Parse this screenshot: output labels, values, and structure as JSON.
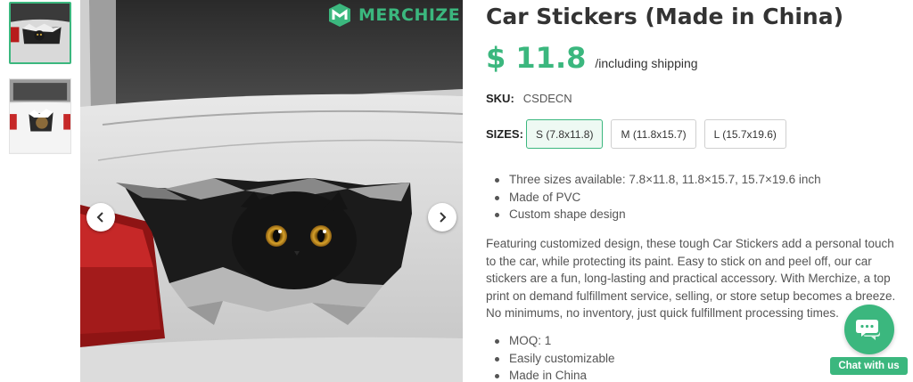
{
  "brand": {
    "watermark": "MERCHIZE",
    "accent_color": "#3bb77e"
  },
  "gallery": {
    "thumbnails": [
      {
        "alt": "cat sticker on car trunk",
        "selected": true
      },
      {
        "alt": "cat sticker on white car",
        "selected": false
      }
    ],
    "prev_icon": "chevron-left-icon",
    "next_icon": "chevron-right-icon"
  },
  "product": {
    "title": "Car Stickers (Made in China)",
    "price": "$ 11.8",
    "price_note": "/including shipping",
    "sku_label": "SKU:",
    "sku": "CSDECN",
    "sizes_label": "SIZES:",
    "sizes": [
      "S (7.8x11.8)",
      "M (11.8x15.7)",
      "L (15.7x19.6)"
    ],
    "selected_size": "S (7.8x11.8)",
    "features": [
      "Three sizes available: 7.8×11.8, 11.8×15.7, 15.7×19.6 inch",
      "Made of PVC",
      "Custom shape design"
    ],
    "description": "Featuring customized design, these tough Car Stickers add a personal touch to the car, while protecting its paint. Easy to stick on and peel off, our car stickers are a fun, long-lasting and practical accessory. With Merchize, a top print on demand fulfillment service, selling, or store setup becomes a breeze. No minimums, no inventory, just quick fulfillment processing times.",
    "details": [
      "MOQ: 1",
      "Easily customizable",
      "Made in China"
    ]
  },
  "chat": {
    "label": "Chat with us",
    "icon": "chat-icon"
  }
}
